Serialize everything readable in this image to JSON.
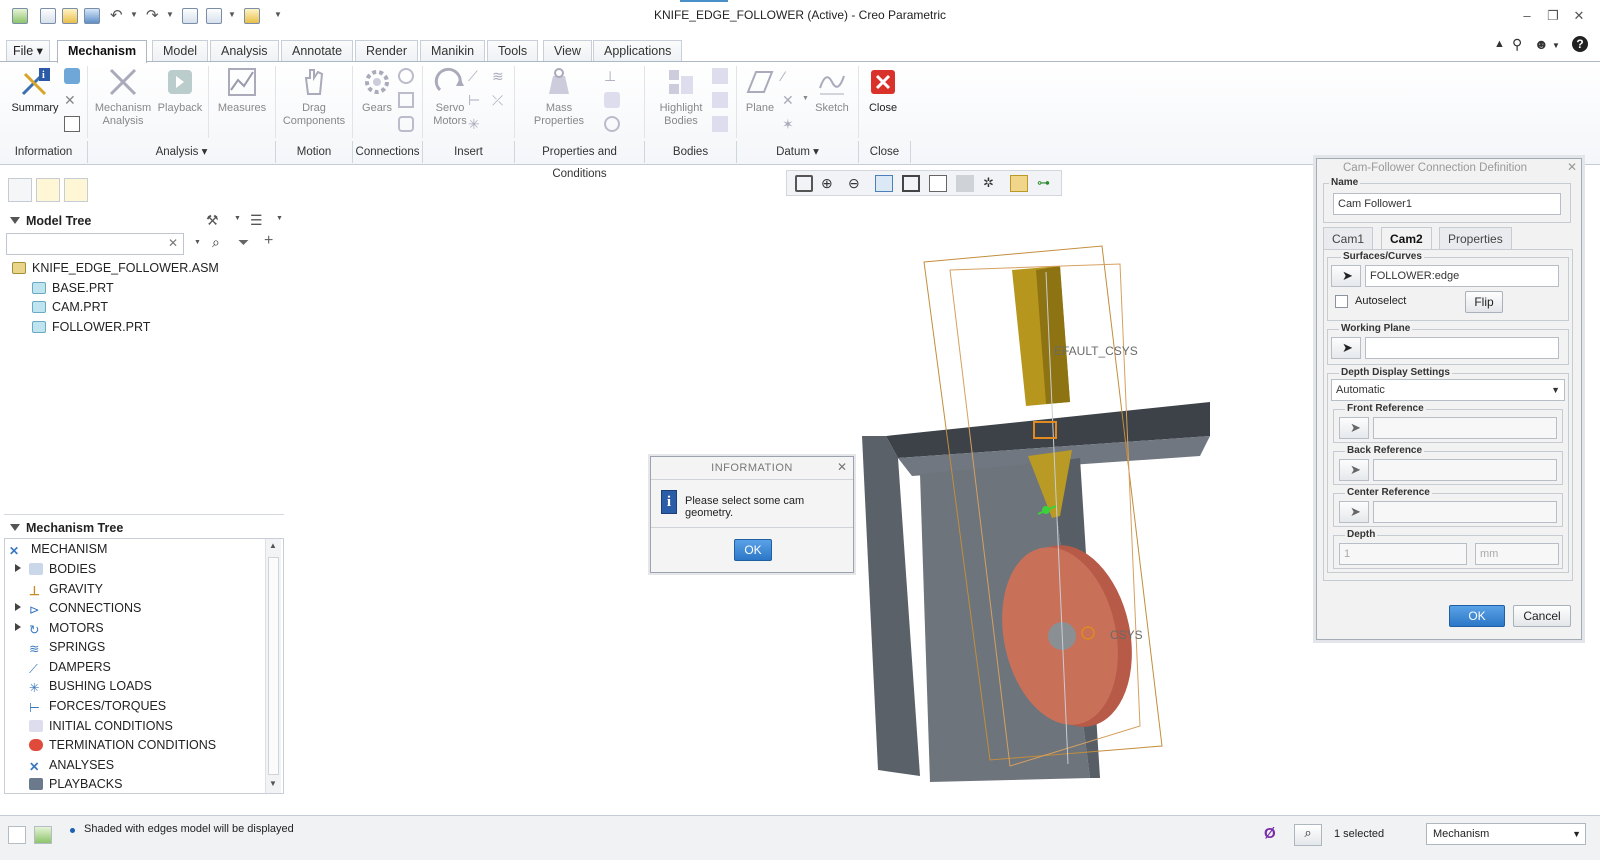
{
  "window": {
    "title": "KNIFE_EDGE_FOLLOWER (Active) - Creo Parametric"
  },
  "menu": {
    "file": "File",
    "tabs": [
      "Mechanism",
      "Model",
      "Analysis",
      "Annotate",
      "Render",
      "Manikin",
      "Tools",
      "View",
      "Applications"
    ]
  },
  "ribbon": {
    "buttons": {
      "summary": "Summary",
      "mechanism_analysis": "Mechanism Analysis",
      "playback": "Playback",
      "measures": "Measures",
      "drag_components": "Drag Components",
      "gears": "Gears",
      "servo_motors": "Servo Motors",
      "mass_properties": "Mass Properties",
      "highlight_bodies": "Highlight Bodies",
      "plane": "Plane",
      "sketch": "Sketch",
      "close": "Close"
    },
    "groups": {
      "information": "Information",
      "analysis": "Analysis",
      "motion": "Motion",
      "connections": "Connections",
      "insert": "Insert",
      "properties": "Properties and Conditions",
      "bodies": "Bodies",
      "datum": "Datum",
      "close": "Close"
    }
  },
  "model_tree": {
    "title": "Model Tree",
    "root": "KNIFE_EDGE_FOLLOWER.ASM",
    "items": [
      "BASE.PRT",
      "CAM.PRT",
      "FOLLOWER.PRT"
    ]
  },
  "mechanism_tree": {
    "title": "Mechanism Tree",
    "root": "MECHANISM",
    "items": [
      "BODIES",
      "GRAVITY",
      "CONNECTIONS",
      "MOTORS",
      "SPRINGS",
      "DAMPERS",
      "BUSHING LOADS",
      "FORCES/TORQUES",
      "INITIAL CONDITIONS",
      "TERMINATION CONDITIONS",
      "ANALYSES",
      "PLAYBACKS"
    ]
  },
  "viewport": {
    "csys_label_1": "EFAULT_CSYS",
    "csys_label_2": "CSYS"
  },
  "info_dialog": {
    "title": "INFORMATION",
    "message": "Please select some cam geometry.",
    "ok": "OK"
  },
  "cam_dialog": {
    "title": "Cam-Follower Connection Definition",
    "name_label": "Name",
    "name_value": "Cam Follower1",
    "tabs": [
      "Cam1",
      "Cam2",
      "Properties"
    ],
    "surfaces_label": "Surfaces/Curves",
    "surfaces_value": "FOLLOWER:edge",
    "autoselect_label": "Autoselect",
    "flip_label": "Flip",
    "working_plane_label": "Working Plane",
    "depth_display_label": "Depth Display Settings",
    "depth_mode": "Automatic",
    "front_reference": "Front Reference",
    "back_reference": "Back Reference",
    "center_reference": "Center Reference",
    "depth_label": "Depth",
    "depth_value": "1",
    "depth_unit": "mm",
    "ok": "OK",
    "cancel": "Cancel"
  },
  "status": {
    "message": "Shaded with edges model will be displayed",
    "selected": "1 selected",
    "filter": "Mechanism"
  }
}
